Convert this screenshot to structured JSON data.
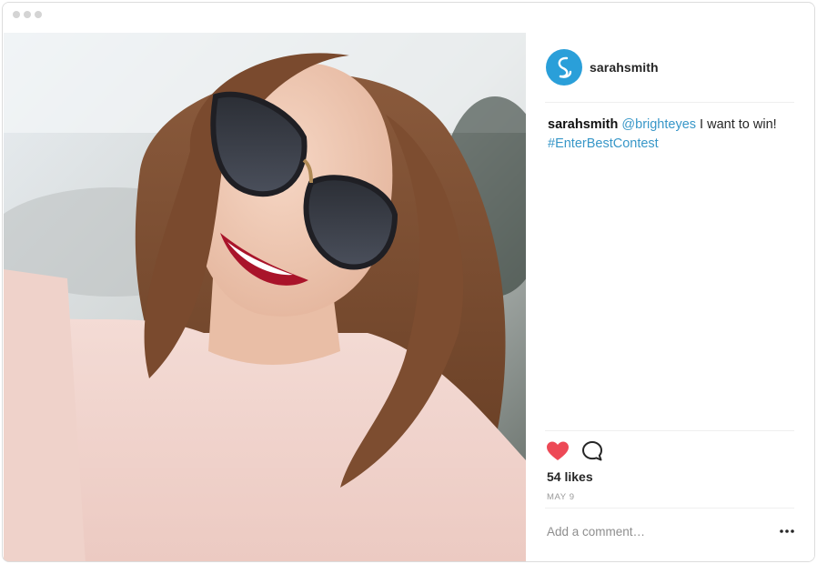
{
  "post": {
    "username": "sarahsmith",
    "avatar_letter": "S",
    "caption": {
      "user": "sarahsmith",
      "mention": "@brighteyes",
      "text": " I want to win!",
      "hashtag": "#EnterBestContest"
    },
    "likes": "54 likes",
    "date": "MAY 9",
    "comment_placeholder": "Add a comment…",
    "more_icon": "more-horizontal-icon",
    "like_icon": "heart-icon",
    "comment_icon": "comment-bubble-icon"
  },
  "colors": {
    "accent_link": "#3897c8",
    "heart": "#ed4956",
    "avatar_bg": "#2a9fd9"
  }
}
